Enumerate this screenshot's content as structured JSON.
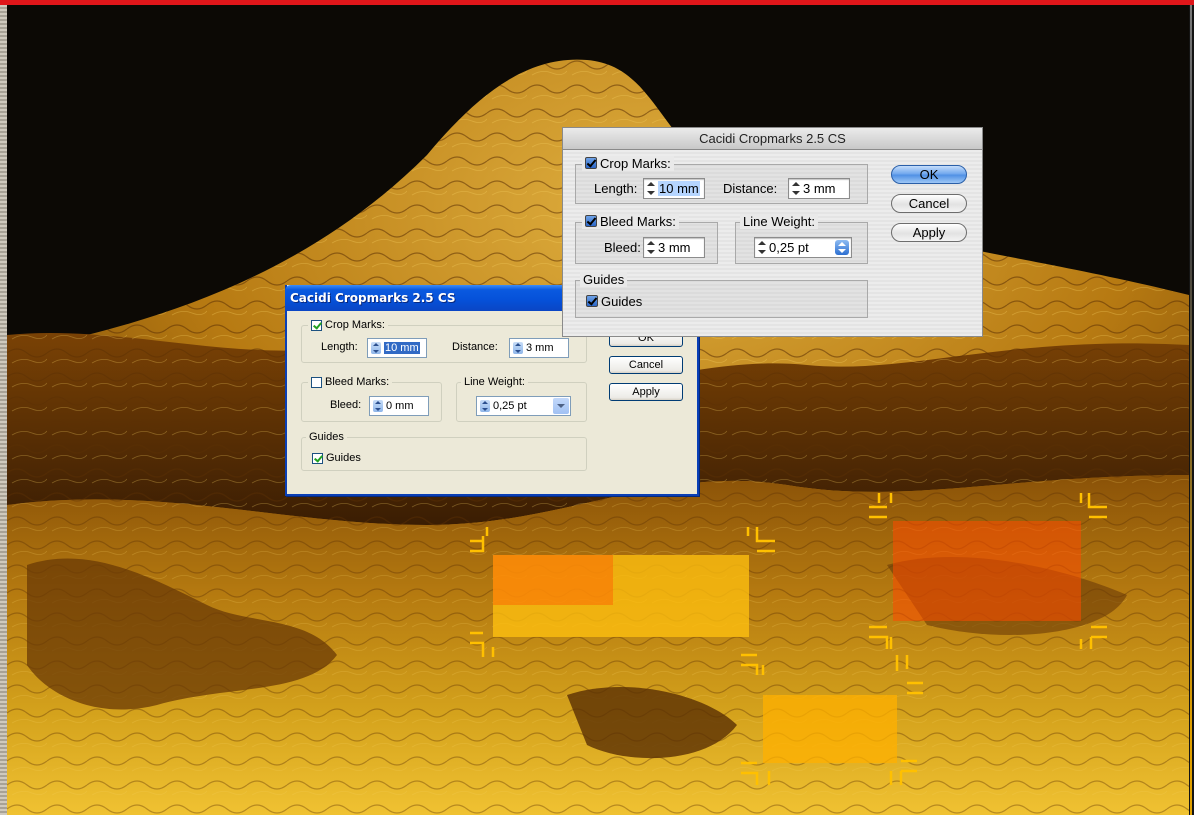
{
  "colors": {
    "top_bar": "#e0161a",
    "xp_title_blue": "#0550d8",
    "xp_face": "#ece9d8",
    "mac_default_button": "#4d8fe4",
    "crop_mark_yellow": "#ffc000",
    "highlight_orange": "#ff5a00"
  },
  "xp_dialog": {
    "title": "Cacidi Cropmarks 2.5 CS",
    "crop_marks": {
      "label": "Crop Marks:",
      "checked": true,
      "length_label": "Length:",
      "length_value": "10 mm",
      "distance_label": "Distance:",
      "distance_value": "3 mm"
    },
    "bleed_marks": {
      "label": "Bleed Marks:",
      "checked": false,
      "bleed_label": "Bleed:",
      "bleed_value": "0 mm"
    },
    "line_weight": {
      "label": "Line Weight:",
      "value": "0,25 pt"
    },
    "guides": {
      "group_label": "Guides",
      "checkbox_label": "Guides",
      "checked": true
    },
    "buttons": {
      "ok": "OK",
      "cancel": "Cancel",
      "apply": "Apply"
    }
  },
  "mac_dialog": {
    "title": "Cacidi Cropmarks 2.5 CS",
    "crop_marks": {
      "label": "Crop Marks:",
      "checked": true,
      "length_label": "Length:",
      "length_value": "10 mm",
      "distance_label": "Distance:",
      "distance_value": "3 mm"
    },
    "bleed_marks": {
      "label": "Bleed Marks:",
      "checked": true,
      "bleed_label": "Bleed:",
      "bleed_value": "3 mm"
    },
    "line_weight": {
      "label": "Line Weight:",
      "value": "0,25 pt"
    },
    "guides": {
      "group_label": "Guides",
      "checkbox_label": "Guides",
      "checked": true
    },
    "buttons": {
      "ok": "OK",
      "cancel": "Cancel",
      "apply": "Apply"
    }
  }
}
